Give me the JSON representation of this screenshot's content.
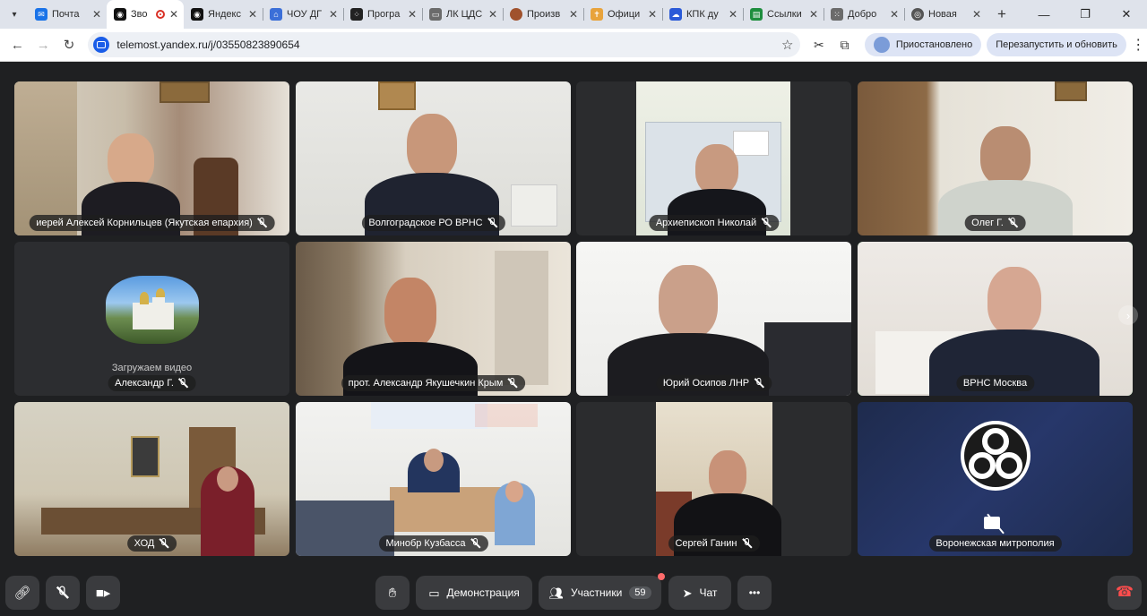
{
  "browser": {
    "tabs": [
      {
        "title": "Почта",
        "favicon_color": "#1a73e8",
        "active": false
      },
      {
        "title": "Зво",
        "favicon_color": "#111111",
        "active": true,
        "recording": true
      },
      {
        "title": "Яндекс",
        "favicon_color": "#111111",
        "active": false
      },
      {
        "title": "ЧОУ ДГ",
        "favicon_color": "#3b6fd8",
        "active": false
      },
      {
        "title": "Програ",
        "favicon_color": "#222222",
        "active": false
      },
      {
        "title": "ЛК ЦДС",
        "favicon_color": "#6b6b6b",
        "active": false
      },
      {
        "title": "Произв",
        "favicon_color": "#a0522d",
        "active": false
      },
      {
        "title": "Офици",
        "favicon_color": "#e8a33b",
        "active": false
      },
      {
        "title": "КПК ду",
        "favicon_color": "#2a5ad8",
        "active": false
      },
      {
        "title": "Ссылки",
        "favicon_color": "#1e8e3e",
        "active": false
      },
      {
        "title": "Добро",
        "favicon_color": "#6b6b6b",
        "active": false
      },
      {
        "title": "Новая",
        "favicon_color": "#555555",
        "active": false
      }
    ],
    "new_tab": "+",
    "url": "telemost.yandex.ru/j/03550823890654",
    "paused_label": "Приостановлено",
    "relaunch_label": "Перезапустить и обновить",
    "window": {
      "minimize": "—",
      "maximize": "❐",
      "close": "✕"
    }
  },
  "participants": [
    {
      "name": "иерей Алексей Корнильцев (Якутская епархия)",
      "muted": true
    },
    {
      "name": "Волгоградское РО ВРНС",
      "muted": true
    },
    {
      "name": "Архиепископ Николай",
      "muted": true
    },
    {
      "name": "Олег Г.",
      "muted": true
    },
    {
      "name": "Александр Г.",
      "muted": true,
      "status": "Загружаем видео"
    },
    {
      "name": "прот. Александр Якушечкин Крым",
      "muted": true
    },
    {
      "name": "Юрий Осипов ЛНР",
      "muted": true
    },
    {
      "name": "ВРНС Москва",
      "muted": false,
      "speaking": true
    },
    {
      "name": "ХОД",
      "muted": true
    },
    {
      "name": "Минобр Кузбасса",
      "muted": true
    },
    {
      "name": "Сергей Ганин",
      "muted": true
    },
    {
      "name": "Воронежская митрополия",
      "muted": false,
      "camera_off": true
    }
  ],
  "toolbar": {
    "demo_label": "Демонстрация",
    "participants_label": "Участники",
    "participants_count": "59",
    "chat_label": "Чат",
    "more_label": "•••"
  },
  "colors": {
    "speaking": "#49d36c",
    "background": "#1f2022",
    "obs_tile": "#1e2b4d"
  }
}
